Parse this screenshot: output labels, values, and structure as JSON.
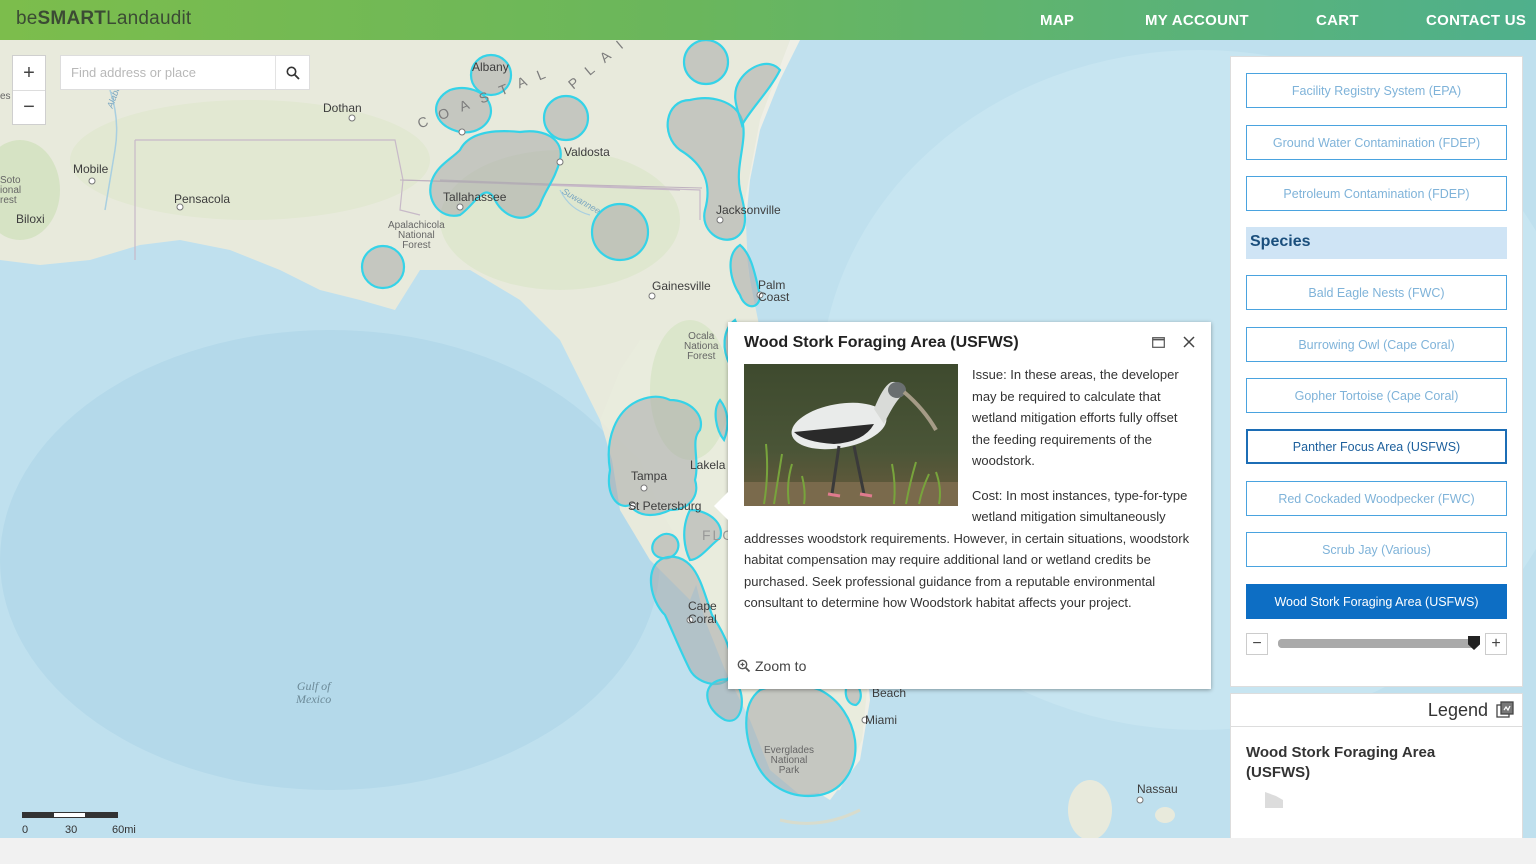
{
  "header": {
    "brand_prefix": "be",
    "brand_strong": "SMART",
    "brand_suffix": "Landaudit",
    "nav": [
      "MAP",
      "MY ACCOUNT",
      "CART",
      "CONTACT US"
    ]
  },
  "map": {
    "zoom_in": "+",
    "zoom_out": "−",
    "search_placeholder": "Find address or place",
    "labels": {
      "albany": "Albany",
      "dothan": "Dothan",
      "mobile": "Mobile",
      "pensacola": "Pensacola",
      "valdosta": "Valdosta",
      "tallahassee": "Tallahassee",
      "jacksonville": "Jacksonville",
      "gainesville": "Gainesville",
      "palm": "Palm",
      "coast": "Coast",
      "tampa": "Tampa",
      "lakeland": "Lakela",
      "stpete": "St Petersburg",
      "fl": "FLO",
      "cape": "Cape",
      "coral": "Coral",
      "beach": "Beach",
      "miami": "Miami",
      "nassau": "Nassau",
      "biloxi": "Biloxi",
      "es": "es",
      "soto1": "Soto",
      "soto2": "ional",
      "soto3": "rest",
      "apalach1": "Apalachicola",
      "apalach2": "National",
      "apalach3": "Forest",
      "ocala1": "Ocala",
      "ocala2": "Nationa",
      "ocala3": "Forest",
      "ever1": "Everglades",
      "ever2": "National",
      "ever3": "Park",
      "gulf1": "Gulf of",
      "gulf2": "Mexico",
      "coastal_c": "C",
      "coastal_o": "O",
      "coastal_a": "A",
      "coastal_s": "S",
      "coastal_t": "T",
      "coastal_a2": "A",
      "coastal_l": "L",
      "plain_p": "P",
      "plain_l": "L",
      "plain_a": "A",
      "plain_i": "I",
      "alabama": "Alabama",
      "suwannee": "Suwannee"
    },
    "scale": {
      "l0": "0",
      "l30": "30",
      "l60": "60mi"
    }
  },
  "popup": {
    "title": "Wood Stork Foraging Area (USFWS)",
    "issue": "Issue: In these areas, the developer may be required to calculate that wetland mitigation efforts fully offset the feeding requirements of the woodstork.",
    "cost": "Cost: In most instances, type-for-type wetland mitigation simultaneously addresses woodstork requirements. However, in certain situations, woodstork habitat compensation may require additional land or wetland credits be purchased. Seek professional guidance from a reputable environmental consultant to determine how Woodstork habitat affects your project.",
    "zoom_to": "Zoom to"
  },
  "panel": {
    "layers_top": [
      "Facility Registry System (EPA)",
      "Ground Water Contamination (FDEP)",
      "Petroleum Contamination (FDEP)"
    ],
    "species_heading": "Species",
    "species": [
      "Bald Eagle Nests (FWC)",
      "Burrowing Owl (Cape Coral)",
      "Gopher Tortoise (Cape Coral)",
      "Panther Focus Area (USFWS)",
      "Red Cockaded Woodpecker (FWC)",
      "Scrub Jay (Various)",
      "Wood Stork Foraging Area (USFWS)"
    ],
    "highlighted_index": 3,
    "active_index": 6,
    "opacity_minus": "−",
    "opacity_plus": "+",
    "opacity_fraction": 0.99
  },
  "legend": {
    "title": "Legend",
    "layer_title": "Wood Stork Foraging Area (USFWS)"
  },
  "colors": {
    "accent": "#0d6ec4",
    "habitat_outline": "#35d3e8",
    "habitat_fill": "#a7a9aa"
  }
}
